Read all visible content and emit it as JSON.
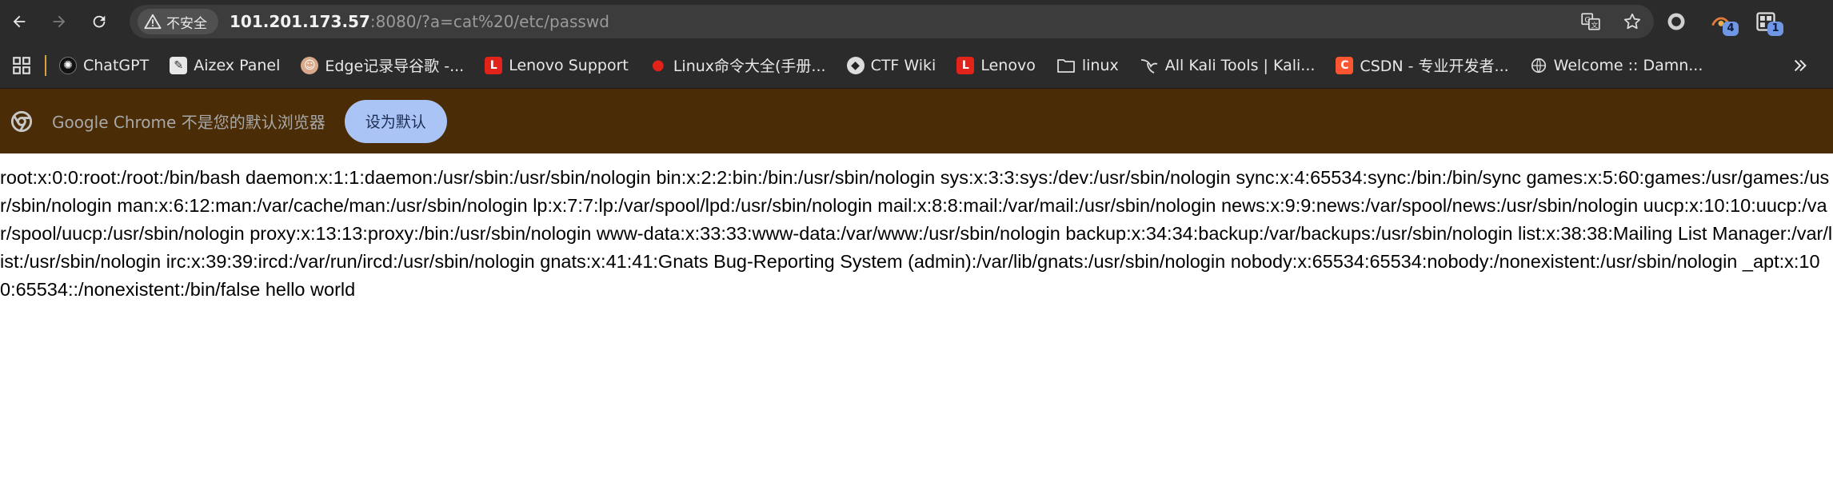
{
  "address_bar": {
    "security_label": "不安全",
    "url_host": "101.201.173.57",
    "url_rest": ":8080/?a=cat%20/etc/passwd"
  },
  "toolbar": {
    "extension_badge_1": "4",
    "extension_badge_2": "1"
  },
  "bookmarks": [
    {
      "label": "ChatGPT",
      "icon": "chatgpt-icon"
    },
    {
      "label": "Aizex Panel",
      "icon": "aizex-icon"
    },
    {
      "label": "Edge记录导谷歌 -...",
      "icon": "edge-import-icon"
    },
    {
      "label": "Lenovo Support",
      "icon": "lenovo-icon"
    },
    {
      "label": "Linux命令大全(手册...",
      "icon": "redhat-icon"
    },
    {
      "label": "CTF Wiki",
      "icon": "ctf-wiki-icon"
    },
    {
      "label": "Lenovo",
      "icon": "lenovo-icon"
    },
    {
      "label": "linux",
      "icon": "folder-icon"
    },
    {
      "label": "All Kali Tools | Kali...",
      "icon": "kali-icon"
    },
    {
      "label": "CSDN - 专业开发者...",
      "icon": "csdn-icon"
    },
    {
      "label": "Welcome :: Damn...",
      "icon": "globe-icon"
    }
  ],
  "infobar": {
    "message": "Google Chrome 不是您的默认浏览器",
    "button_label": "设为默认"
  },
  "page": {
    "body_text": "root:x:0:0:root:/root:/bin/bash daemon:x:1:1:daemon:/usr/sbin:/usr/sbin/nologin bin:x:2:2:bin:/bin:/usr/sbin/nologin sys:x:3:3:sys:/dev:/usr/sbin/nologin sync:x:4:65534:sync:/bin:/bin/sync games:x:5:60:games:/usr/games:/usr/sbin/nologin man:x:6:12:man:/var/cache/man:/usr/sbin/nologin lp:x:7:7:lp:/var/spool/lpd:/usr/sbin/nologin mail:x:8:8:mail:/var/mail:/usr/sbin/nologin news:x:9:9:news:/var/spool/news:/usr/sbin/nologin uucp:x:10:10:uucp:/var/spool/uucp:/usr/sbin/nologin proxy:x:13:13:proxy:/bin:/usr/sbin/nologin www-data:x:33:33:www-data:/var/www:/usr/sbin/nologin backup:x:34:34:backup:/var/backups:/usr/sbin/nologin list:x:38:38:Mailing List Manager:/var/list:/usr/sbin/nologin irc:x:39:39:ircd:/var/run/ircd:/usr/sbin/nologin gnats:x:41:41:Gnats Bug-Reporting System (admin):/var/lib/gnats:/usr/sbin/nologin nobody:x:65534:65534:nobody:/nonexistent:/usr/sbin/nologin _apt:x:100:65534::/nonexistent:/bin/false hello world"
  },
  "colors": {
    "toolbar_bg": "#2b2b2b",
    "omnibox_bg": "#3c3c3c",
    "infobar_bg": "#4a2c06",
    "infobar_button_bg": "#a9c4f5"
  }
}
